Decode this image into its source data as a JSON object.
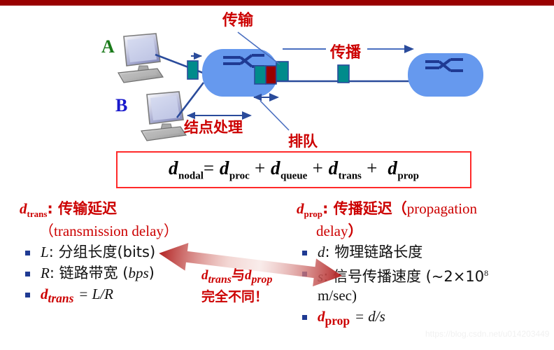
{
  "slide": {
    "top_bar_color": "#990000",
    "watermark": "https://blog.csdn.net/u014203449"
  },
  "diagram": {
    "host_a_label": "A",
    "host_b_label": "B",
    "labels": {
      "transmission": "传输",
      "propagation": "传播",
      "nodal_processing": "结点处理",
      "queueing": "排队"
    },
    "colors": {
      "cloud": "#6699EE",
      "router_symbol": "#1F3A93",
      "packet_teal": "#008B8B",
      "packet_red": "#990000",
      "link": "#2A4B9B",
      "label_red": "#CC0000",
      "host_a": "#1A7A1A",
      "host_b": "#1A1ACC"
    }
  },
  "formula": {
    "lhs_var": "d",
    "lhs_sub": "nodal",
    "equals": "=",
    "terms": [
      {
        "var": "d",
        "sub": "proc"
      },
      {
        "var": "d",
        "sub": "queue"
      },
      {
        "var": "d",
        "sub": "trans"
      },
      {
        "var": "d",
        "sub": "prop"
      }
    ],
    "plus": "+",
    "border_color": "#FF2A2A",
    "plain_text": "dnodal = dproc + dqueue + dtrans + dprop"
  },
  "left_column": {
    "heading_var": "d",
    "heading_sub": "trans",
    "heading_cn": ": 传输延迟",
    "heading_en": "（transmission delay）",
    "bullets": [
      {
        "id": "L",
        "text": ": 分组长度(bits)"
      },
      {
        "id": "R",
        "text": ": 链路带宽 (bps)"
      },
      {
        "id": "dtrans",
        "text": "= L/R"
      }
    ],
    "bullet_R_prefix": ": 链路带宽 (",
    "bullet_R_italic": "bps",
    "bullet_R_suffix": ")",
    "bullet_L_prefix": ": 分组长度(bits)",
    "formula_var": "d",
    "formula_sub": "trans",
    "formula_rhs": "= L/R"
  },
  "right_column": {
    "heading_var": "d",
    "heading_sub": "prop",
    "heading_cn": ": 传播延迟（",
    "heading_en1": "propagation",
    "heading_en2": "delay",
    "heading_close": "）",
    "bullets": [
      {
        "id": "d",
        "text": ": 物理链路长度"
      },
      {
        "id": "s",
        "text": ": 信号传播速度 (~2×10",
        "sup": "8",
        "cont": "m/sec)"
      },
      {
        "id": "dprop",
        "text": "= d/s"
      }
    ],
    "bullet_s_prefix": ": 信号传播速度 (~2×10",
    "bullet_s_sup": "8",
    "bullet_s_cont": "m/sec)",
    "formula_var": "d",
    "formula_sub": "prop",
    "formula_rhs": "= d/s"
  },
  "center_note": {
    "line1_var1": "d",
    "line1_sub1": "trans",
    "line1_mid": "与",
    "line1_var2": "d",
    "line1_sub2": "prop",
    "line2": "完全不同！",
    "arrow_color": "#C0392B"
  }
}
